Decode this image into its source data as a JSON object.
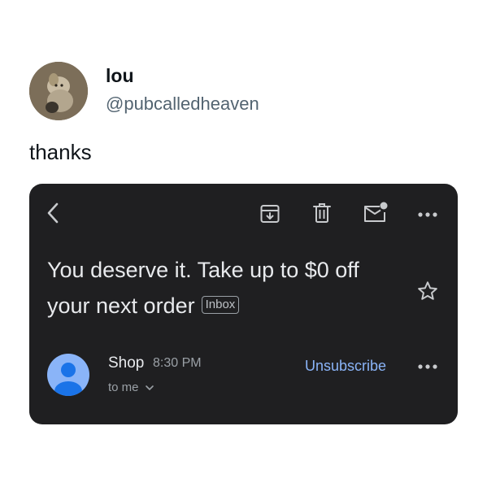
{
  "tweet": {
    "author_name": "lou",
    "author_handle": "@pubcalledheaven",
    "text": "thanks"
  },
  "email": {
    "toolbar": {
      "back_icon": "chevron-left-icon",
      "archive_icon": "archive-icon",
      "delete_icon": "trash-icon",
      "mark_unread_icon": "mail-unread-icon",
      "more_icon": "more-horizontal-icon"
    },
    "subject_line1": "You deserve it. Take up to $0 off",
    "subject_line2": "your next order",
    "label_chip": "Inbox",
    "sender": {
      "name": "Shop",
      "time": "8:30 PM",
      "recipient": "to me"
    },
    "unsubscribe_label": "Unsubscribe"
  },
  "colors": {
    "card_background": "#1f1f21",
    "link_blue": "#8ab4f8",
    "handle_gray": "#536471",
    "text_light": "#e8eaed"
  }
}
